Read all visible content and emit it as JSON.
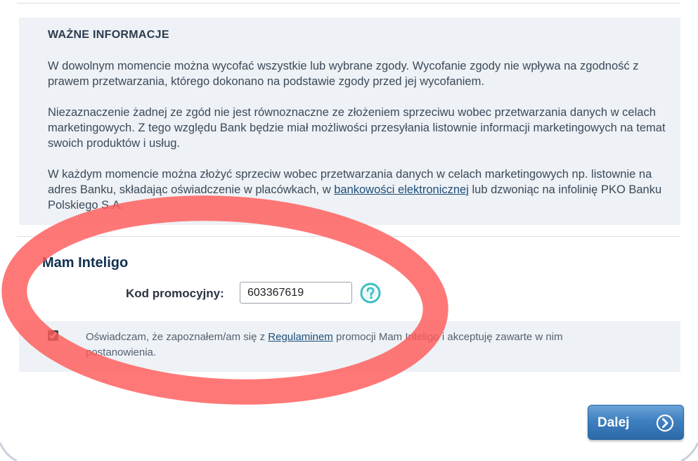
{
  "info": {
    "title": "WAŻNE INFORMACJE",
    "para1": "W dowolnym momencie można wycofać wszystkie lub wybrane zgody. Wycofanie zgody nie wpływa na zgodność z prawem przetwarzania, którego dokonano na podstawie zgody przed jej wycofaniem.",
    "para2": "Niezaznaczenie żadnej ze zgód nie jest równoznaczne ze złożeniem sprzeciwu wobec przetwarzania danych w celach marketingowych. Z tego względu Bank będzie miał możliwości przesyłania listownie informacji marketingowych na temat swoich produktów i usług.",
    "para3_before": "W każdym momencie można złożyć sprzeciw wobec przetwarzania danych w celach marketingowych np. listownie na adres Banku, składając oświadczenie w placówkach, w ",
    "para3_link": "bankowości elektronicznej",
    "para3_after": "  lub dzwoniąc na infolinię PKO Banku Polskiego S.A."
  },
  "section": {
    "title": "Mam Inteligo"
  },
  "promo": {
    "label": "Kod promocyjny:",
    "value": "603367619",
    "help_icon": "help-circle-icon"
  },
  "consent": {
    "checked": true,
    "text_before": "Oświadczam, że zapoznałem/am się z ",
    "link": "Regulaminem",
    "text_after": " promocji Mam Inteligo i akceptuję zawarte w nim postanowienia."
  },
  "next_button": {
    "label": "Dalej",
    "icon": "arrow-right-circle-icon"
  },
  "colors": {
    "accent_blue": "#3f80c0",
    "help_teal": "#3bbfc4",
    "annotation_red": "#ff5a5a",
    "panel_bg": "#eef1f5"
  }
}
